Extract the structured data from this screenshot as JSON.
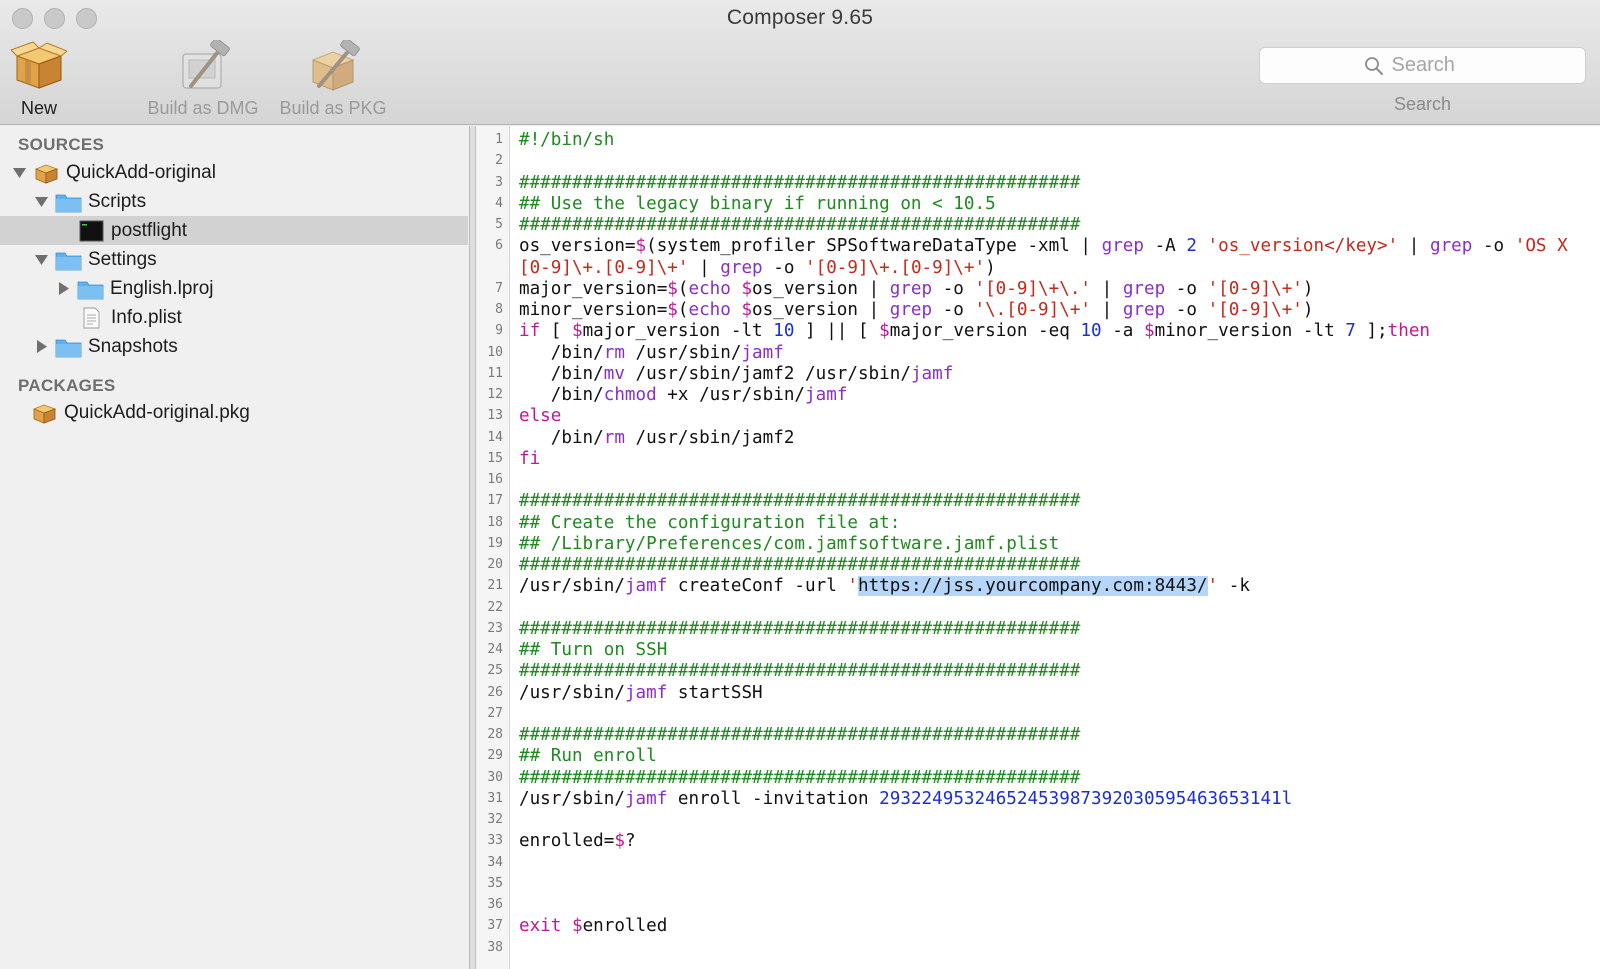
{
  "window": {
    "title": "Composer 9.65"
  },
  "toolbar": {
    "new_label": "New",
    "build_dmg_label": "Build as DMG",
    "build_pkg_label": "Build as PKG",
    "search_placeholder": "Search",
    "search_caption": "Search"
  },
  "sidebar": {
    "sources_header": "SOURCES",
    "packages_header": "PACKAGES",
    "source_root": "QuickAdd-original",
    "scripts": "Scripts",
    "postflight": "postflight",
    "settings": "Settings",
    "english_lproj": "English.lproj",
    "info_plist": "Info.plist",
    "snapshots": "Snapshots",
    "package_item": "QuickAdd-original.pkg"
  },
  "editor": {
    "lines": [
      {
        "num": "1",
        "tokens": [
          [
            "com",
            "#!/bin/sh"
          ]
        ]
      },
      {
        "num": "2",
        "tokens": []
      },
      {
        "num": "3",
        "tokens": [
          [
            "com",
            "#####################################################"
          ]
        ]
      },
      {
        "num": "4",
        "tokens": [
          [
            "com",
            "## Use the legacy binary if running on < 10.5"
          ]
        ]
      },
      {
        "num": "5",
        "tokens": [
          [
            "com",
            "#####################################################"
          ]
        ]
      },
      {
        "num": "6",
        "wrap": true,
        "tokens": [
          [
            "plain",
            "os_version="
          ],
          [
            "kw",
            "$"
          ],
          [
            "plain",
            "(system_profiler SPSoftwareDataType -xml | "
          ],
          [
            "cmd",
            "grep"
          ],
          [
            "plain",
            " -A "
          ],
          [
            "num",
            "2"
          ],
          [
            "plain",
            " "
          ],
          [
            "str",
            "'os_version</key>'"
          ],
          [
            "plain",
            " | "
          ],
          [
            "cmd",
            "grep"
          ],
          [
            "plain",
            " -o "
          ],
          [
            "str",
            "'OS X"
          ],
          [
            "nl",
            ""
          ],
          [
            "str",
            "[0-9]\\+.[0-9]\\+'"
          ],
          [
            "plain",
            " | "
          ],
          [
            "cmd",
            "grep"
          ],
          [
            "plain",
            " -o "
          ],
          [
            "str",
            "'[0-9]\\+.[0-9]\\+'"
          ],
          [
            "plain",
            ")"
          ]
        ]
      },
      {
        "num": "7",
        "tokens": [
          [
            "plain",
            "major_version="
          ],
          [
            "kw",
            "$"
          ],
          [
            "plain",
            "("
          ],
          [
            "cmd",
            "echo"
          ],
          [
            "plain",
            " "
          ],
          [
            "kw",
            "$"
          ],
          [
            "plain",
            "os_version | "
          ],
          [
            "cmd",
            "grep"
          ],
          [
            "plain",
            " -o "
          ],
          [
            "str",
            "'[0-9]\\+\\.'"
          ],
          [
            "plain",
            " | "
          ],
          [
            "cmd",
            "grep"
          ],
          [
            "plain",
            " -o "
          ],
          [
            "str",
            "'[0-9]\\+'"
          ],
          [
            "plain",
            ")"
          ]
        ]
      },
      {
        "num": "8",
        "tokens": [
          [
            "plain",
            "minor_version="
          ],
          [
            "kw",
            "$"
          ],
          [
            "plain",
            "("
          ],
          [
            "cmd",
            "echo"
          ],
          [
            "plain",
            " "
          ],
          [
            "kw",
            "$"
          ],
          [
            "plain",
            "os_version | "
          ],
          [
            "cmd",
            "grep"
          ],
          [
            "plain",
            " -o "
          ],
          [
            "str",
            "'\\.[0-9]\\+'"
          ],
          [
            "plain",
            " | "
          ],
          [
            "cmd",
            "grep"
          ],
          [
            "plain",
            " -o "
          ],
          [
            "str",
            "'[0-9]\\+'"
          ],
          [
            "plain",
            ")"
          ]
        ]
      },
      {
        "num": "9",
        "tokens": [
          [
            "kw",
            "if"
          ],
          [
            "plain",
            " [ "
          ],
          [
            "kw",
            "$"
          ],
          [
            "plain",
            "major_version -lt "
          ],
          [
            "num",
            "10"
          ],
          [
            "plain",
            " ] || [ "
          ],
          [
            "kw",
            "$"
          ],
          [
            "plain",
            "major_version -eq "
          ],
          [
            "num",
            "10"
          ],
          [
            "plain",
            " -a "
          ],
          [
            "kw",
            "$"
          ],
          [
            "plain",
            "minor_version -lt "
          ],
          [
            "num",
            "7"
          ],
          [
            "plain",
            " ];"
          ],
          [
            "kw",
            "then"
          ]
        ]
      },
      {
        "num": "10",
        "tokens": [
          [
            "plain",
            "   /bin/"
          ],
          [
            "cmd",
            "rm"
          ],
          [
            "plain",
            " /usr/sbin/"
          ],
          [
            "cmd",
            "jamf"
          ]
        ]
      },
      {
        "num": "11",
        "tokens": [
          [
            "plain",
            "   /bin/"
          ],
          [
            "cmd",
            "mv"
          ],
          [
            "plain",
            " /usr/sbin/jamf2 /usr/sbin/"
          ],
          [
            "cmd",
            "jamf"
          ]
        ]
      },
      {
        "num": "12",
        "tokens": [
          [
            "plain",
            "   /bin/"
          ],
          [
            "cmd",
            "chmod"
          ],
          [
            "plain",
            " +x /usr/sbin/"
          ],
          [
            "cmd",
            "jamf"
          ]
        ]
      },
      {
        "num": "13",
        "tokens": [
          [
            "kw",
            "else"
          ]
        ]
      },
      {
        "num": "14",
        "tokens": [
          [
            "plain",
            "   /bin/"
          ],
          [
            "cmd",
            "rm"
          ],
          [
            "plain",
            " /usr/sbin/jamf2"
          ]
        ]
      },
      {
        "num": "15",
        "tokens": [
          [
            "kw",
            "fi"
          ]
        ]
      },
      {
        "num": "16",
        "tokens": []
      },
      {
        "num": "17",
        "tokens": [
          [
            "com",
            "#####################################################"
          ]
        ]
      },
      {
        "num": "18",
        "tokens": [
          [
            "com",
            "## Create the configuration file at:"
          ]
        ]
      },
      {
        "num": "19",
        "tokens": [
          [
            "com",
            "## /Library/Preferences/com.jamfsoftware.jamf.plist"
          ]
        ]
      },
      {
        "num": "20",
        "tokens": [
          [
            "com",
            "#####################################################"
          ]
        ]
      },
      {
        "num": "21",
        "tokens": [
          [
            "plain",
            "/usr/sbin/"
          ],
          [
            "cmd",
            "jamf"
          ],
          [
            "plain",
            " createConf -url "
          ],
          [
            "str",
            "'"
          ],
          [
            "sel",
            "https://jss.yourcompany.com:8443/"
          ],
          [
            "str",
            "'"
          ],
          [
            "plain",
            " -k"
          ]
        ]
      },
      {
        "num": "22",
        "tokens": []
      },
      {
        "num": "23",
        "tokens": [
          [
            "com",
            "#####################################################"
          ]
        ]
      },
      {
        "num": "24",
        "tokens": [
          [
            "com",
            "## Turn on SSH"
          ]
        ]
      },
      {
        "num": "25",
        "tokens": [
          [
            "com",
            "#####################################################"
          ]
        ]
      },
      {
        "num": "26",
        "tokens": [
          [
            "plain",
            "/usr/sbin/"
          ],
          [
            "cmd",
            "jamf"
          ],
          [
            "plain",
            " startSSH"
          ]
        ]
      },
      {
        "num": "27",
        "tokens": []
      },
      {
        "num": "28",
        "tokens": [
          [
            "com",
            "#####################################################"
          ]
        ]
      },
      {
        "num": "29",
        "tokens": [
          [
            "com",
            "## Run enroll"
          ]
        ]
      },
      {
        "num": "30",
        "tokens": [
          [
            "com",
            "#####################################################"
          ]
        ]
      },
      {
        "num": "31",
        "tokens": [
          [
            "plain",
            "/usr/sbin/"
          ],
          [
            "cmd",
            "jamf"
          ],
          [
            "plain",
            " enroll -invitation "
          ],
          [
            "num",
            "29322495324652453987392030595463653141l"
          ]
        ]
      },
      {
        "num": "32",
        "tokens": []
      },
      {
        "num": "33",
        "tokens": [
          [
            "plain",
            "enrolled="
          ],
          [
            "kw",
            "$"
          ],
          [
            "plain",
            "?"
          ]
        ]
      },
      {
        "num": "34",
        "tokens": []
      },
      {
        "num": "35",
        "tokens": []
      },
      {
        "num": "36",
        "tokens": []
      },
      {
        "num": "37",
        "tokens": [
          [
            "kw",
            "exit"
          ],
          [
            "plain",
            " "
          ],
          [
            "kw",
            "$"
          ],
          [
            "plain",
            "enrolled"
          ]
        ]
      },
      {
        "num": "38",
        "tokens": []
      }
    ]
  },
  "icons": {
    "new": "package-icon",
    "build_dmg": "hammer-disk-icon",
    "build_pkg": "hammer-package-icon",
    "search": "magnifier-icon"
  },
  "colors": {
    "comment": "#1f8a1f",
    "keyword": "#c0169a",
    "command": "#8a2ec9",
    "string": "#c6281a",
    "number": "#1a2fd0",
    "selection": "#b5d5fb",
    "folder": "#5fb0ee"
  }
}
